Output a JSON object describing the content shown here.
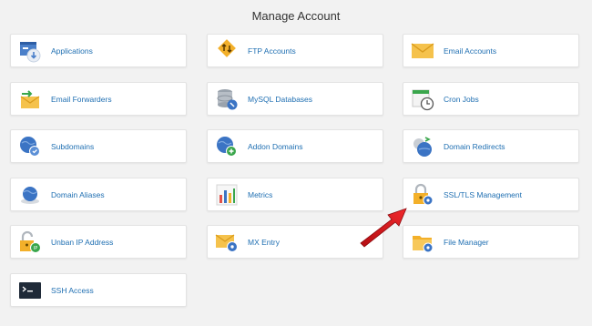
{
  "page_title": "Manage Account",
  "tiles": [
    {
      "label": "Applications",
      "icon": "applications-icon"
    },
    {
      "label": "FTP Accounts",
      "icon": "ftp-accounts-icon"
    },
    {
      "label": "Email Accounts",
      "icon": "email-accounts-icon"
    },
    {
      "label": "Email Forwarders",
      "icon": "email-forwarders-icon"
    },
    {
      "label": "MySQL Databases",
      "icon": "mysql-databases-icon"
    },
    {
      "label": "Cron Jobs",
      "icon": "cron-jobs-icon"
    },
    {
      "label": "Subdomains",
      "icon": "subdomains-icon"
    },
    {
      "label": "Addon Domains",
      "icon": "addon-domains-icon"
    },
    {
      "label": "Domain Redirects",
      "icon": "domain-redirects-icon"
    },
    {
      "label": "Domain Aliases",
      "icon": "domain-aliases-icon"
    },
    {
      "label": "Metrics",
      "icon": "metrics-icon"
    },
    {
      "label": "SSL/TLS Management",
      "icon": "ssl-tls-icon"
    },
    {
      "label": "Unban IP Address",
      "icon": "unban-ip-icon"
    },
    {
      "label": "MX Entry",
      "icon": "mx-entry-icon"
    },
    {
      "label": "File Manager",
      "icon": "file-manager-icon"
    },
    {
      "label": "SSH Access",
      "icon": "ssh-access-icon"
    }
  ],
  "colors": {
    "link": "#1f6fb2",
    "tile_bg": "#ffffff",
    "page_bg": "#f2f2f2",
    "arrow": "#d9151b"
  }
}
